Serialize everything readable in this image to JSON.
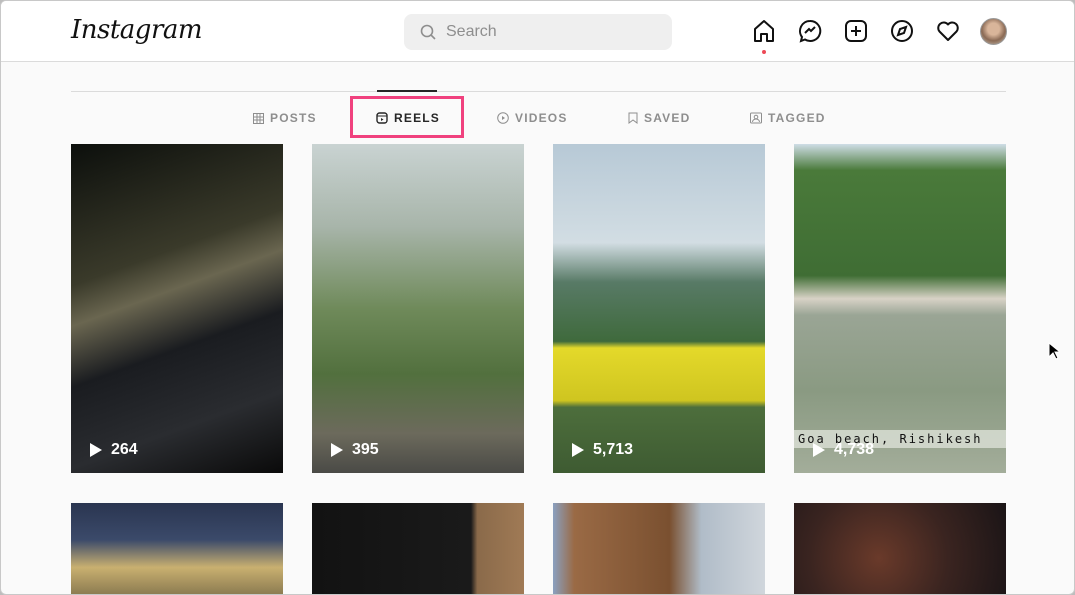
{
  "header": {
    "logo": "Instagram",
    "search_placeholder": "Search"
  },
  "tabs": [
    {
      "label": "POSTS"
    },
    {
      "label": "REELS"
    },
    {
      "label": "VIDEOS"
    },
    {
      "label": "SAVED"
    },
    {
      "label": "TAGGED"
    }
  ],
  "active_tab": "REELS",
  "reels": [
    {
      "views": "264"
    },
    {
      "views": "395"
    },
    {
      "views": "5,713"
    },
    {
      "views": "4,738",
      "caption": "Goa beach, Rishikesh"
    }
  ],
  "colors": {
    "highlight": "#f0417e",
    "notification": "#ed4956"
  }
}
